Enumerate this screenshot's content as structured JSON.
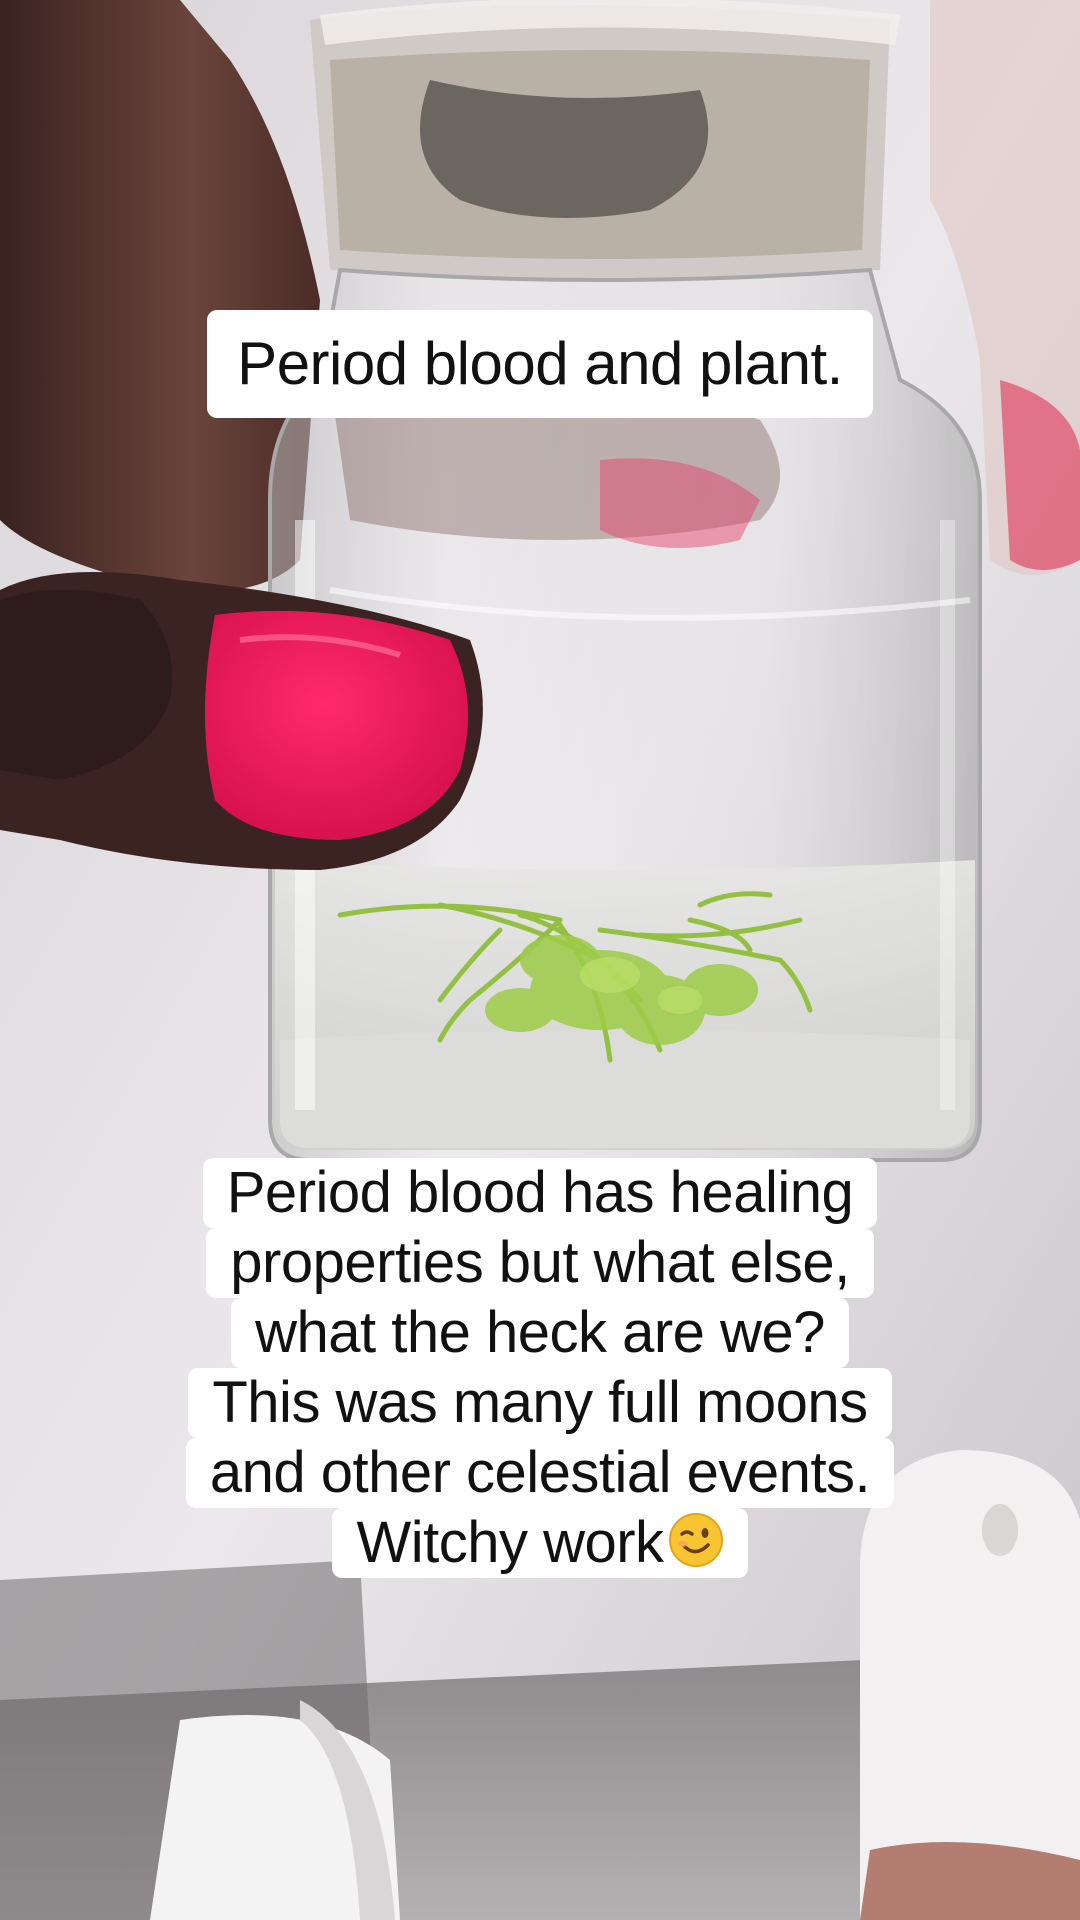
{
  "captions": {
    "top": "Period blood and plant.",
    "bottom_lines": [
      "Period blood has healing",
      "properties but what else,",
      "what the heck are we?",
      "This was many full moons",
      "and other celestial events.",
      "Witchy work"
    ],
    "bottom_emoji": "winking-face-icon"
  },
  "colors": {
    "nail_polish": "#f0185a",
    "plant": "#8fbf3a",
    "caption_bg": "#ffffff",
    "caption_text": "#111111"
  }
}
